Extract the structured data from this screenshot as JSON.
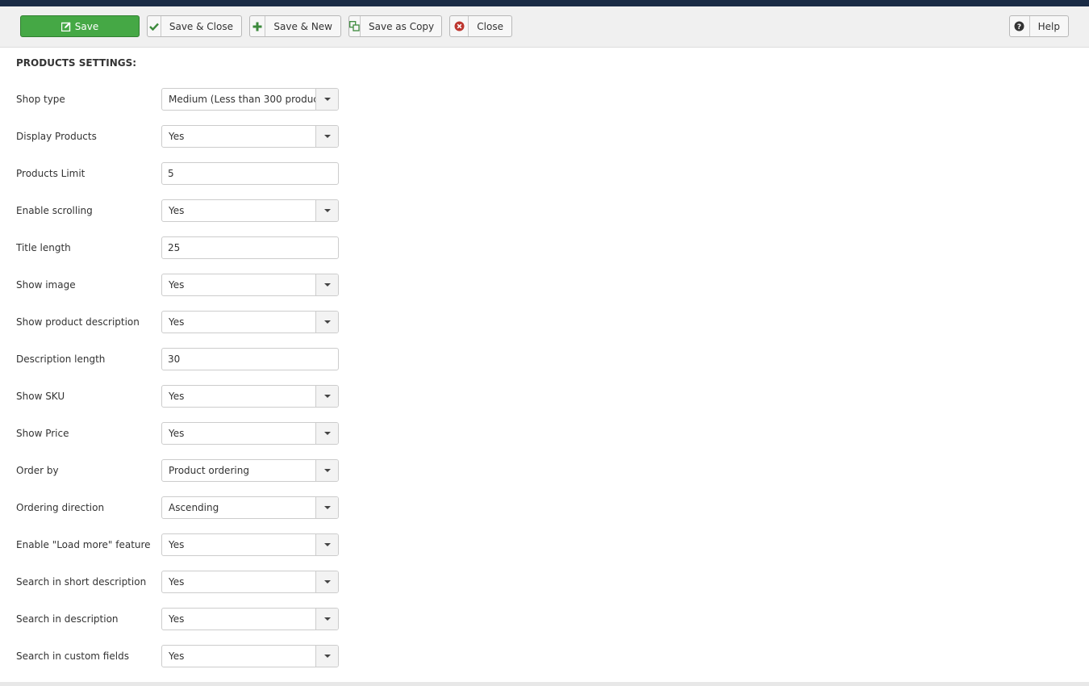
{
  "toolbar": {
    "save_label": "Save",
    "save_close_label": "Save & Close",
    "save_new_label": "Save & New",
    "save_copy_label": "Save as Copy",
    "close_label": "Close",
    "help_label": "Help"
  },
  "section": {
    "title": "PRODUCTS SETTINGS:"
  },
  "fields": [
    {
      "label": "Shop type",
      "value": "Medium (Less than 300 produc...",
      "type": "select"
    },
    {
      "label": "Display Products",
      "value": "Yes",
      "type": "select"
    },
    {
      "label": "Products Limit",
      "value": "5",
      "type": "text"
    },
    {
      "label": "Enable scrolling",
      "value": "Yes",
      "type": "select"
    },
    {
      "label": "Title length",
      "value": "25",
      "type": "text"
    },
    {
      "label": "Show image",
      "value": "Yes",
      "type": "select"
    },
    {
      "label": "Show product description",
      "value": "Yes",
      "type": "select"
    },
    {
      "label": "Description length",
      "value": "30",
      "type": "text"
    },
    {
      "label": "Show SKU",
      "value": "Yes",
      "type": "select"
    },
    {
      "label": "Show Price",
      "value": "Yes",
      "type": "select"
    },
    {
      "label": "Order by",
      "value": "Product ordering",
      "type": "select"
    },
    {
      "label": "Ordering direction",
      "value": "Ascending",
      "type": "select"
    },
    {
      "label": "Enable \"Load more\" feature",
      "value": "Yes",
      "type": "select"
    },
    {
      "label": "Search in short description",
      "value": "Yes",
      "type": "select"
    },
    {
      "label": "Search in description",
      "value": "Yes",
      "type": "select"
    },
    {
      "label": "Search in custom fields",
      "value": "Yes",
      "type": "select"
    }
  ],
  "colors": {
    "save_green": "#45a845",
    "topbar": "#1a2b45",
    "check_green": "#3c8a3c",
    "close_red": "#bd362f"
  }
}
